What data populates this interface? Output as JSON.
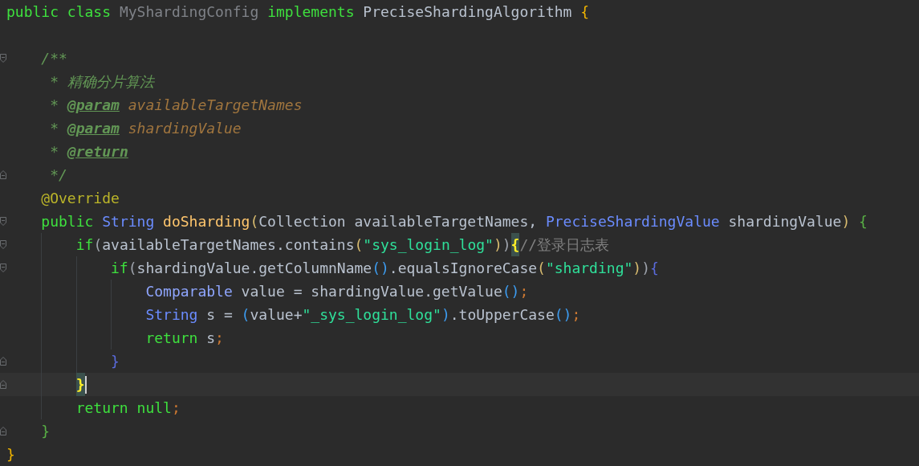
{
  "editor": {
    "lines": [
      {
        "tokens": [
          {
            "kind": "keyword",
            "text": "public class "
          },
          {
            "kind": "unused",
            "text": "MyShardingConfig "
          },
          {
            "kind": "keyword",
            "text": "implements "
          },
          {
            "kind": "plain",
            "text": "PreciseShardingAlgorithm "
          },
          {
            "kind": "brace",
            "text": "{"
          }
        ],
        "children": [
          {
            "fold_start": true,
            "tokens": [
              {
                "kind": "doc",
                "text": "/**"
              }
            ]
          },
          {
            "tokens": [
              {
                "kind": "doc",
                "text": " * 精确分片算法"
              }
            ]
          },
          {
            "tokens": [
              {
                "kind": "doc",
                "text": " * "
              },
              {
                "kind": "doctag",
                "text": "@param"
              },
              {
                "kind": "docparam",
                "text": " availableTargetNames"
              }
            ]
          },
          {
            "tokens": [
              {
                "kind": "doc",
                "text": " * "
              },
              {
                "kind": "doctag",
                "text": "@param"
              },
              {
                "kind": "docparam",
                "text": " shardingValue"
              }
            ]
          },
          {
            "tokens": [
              {
                "kind": "doc",
                "text": " * "
              },
              {
                "kind": "doctag",
                "text": "@return"
              }
            ]
          },
          {
            "fold_end": true,
            "tokens": [
              {
                "kind": "doc",
                "text": " */"
              }
            ]
          },
          {
            "tokens": [
              {
                "kind": "annotation",
                "text": "@Override"
              }
            ]
          },
          {
            "fold_start": true,
            "tokens": [
              {
                "kind": "keyword",
                "text": "public "
              },
              {
                "kind": "type",
                "text": "String "
              },
              {
                "kind": "method",
                "text": "doSharding"
              },
              {
                "kind": "paren-a",
                "text": "("
              },
              {
                "kind": "plain",
                "text": "Collection availableTargetNames, "
              },
              {
                "kind": "type",
                "text": "PreciseShardingValue "
              },
              {
                "kind": "plain",
                "text": "shardingValue"
              },
              {
                "kind": "paren-a",
                "text": ")"
              },
              {
                "kind": "paren-c",
                "text": " {"
              }
            ],
            "children": [
              {
                "fold_start": true,
                "tokens": [
                  {
                    "kind": "keyword",
                    "text": "if"
                  },
                  {
                    "kind": "paren-d",
                    "text": "("
                  },
                  {
                    "kind": "plain",
                    "text": "availableTargetNames.contains"
                  },
                  {
                    "kind": "paren-a",
                    "text": "("
                  },
                  {
                    "kind": "string",
                    "text": "\"sys_login_log\""
                  },
                  {
                    "kind": "paren-a",
                    "text": ")"
                  },
                  {
                    "kind": "paren-d",
                    "text": ")"
                  },
                  {
                    "kind": "brace-match",
                    "text": "{"
                  },
                  {
                    "kind": "comment",
                    "text": "//登录日志表"
                  }
                ],
                "children": [
                  {
                    "fold_start": true,
                    "tokens": [
                      {
                        "kind": "keyword",
                        "text": "if"
                      },
                      {
                        "kind": "paren-d",
                        "text": "("
                      },
                      {
                        "kind": "plain",
                        "text": "shardingValue.getColumnName"
                      },
                      {
                        "kind": "paren-b",
                        "text": "()"
                      },
                      {
                        "kind": "plain",
                        "text": ".equalsIgnoreCase"
                      },
                      {
                        "kind": "paren-a",
                        "text": "("
                      },
                      {
                        "kind": "string",
                        "text": "\"sharding\""
                      },
                      {
                        "kind": "paren-a",
                        "text": ")"
                      },
                      {
                        "kind": "paren-d",
                        "text": ")"
                      },
                      {
                        "kind": "paren-e",
                        "text": "{"
                      }
                    ],
                    "children": [
                      {
                        "tokens": [
                          {
                            "kind": "type-light",
                            "text": "Comparable "
                          },
                          {
                            "kind": "plain",
                            "text": "value = shardingValue.getValue"
                          },
                          {
                            "kind": "paren-b",
                            "text": "()"
                          },
                          {
                            "kind": "semicolon",
                            "text": ";"
                          }
                        ]
                      },
                      {
                        "tokens": [
                          {
                            "kind": "type",
                            "text": "String "
                          },
                          {
                            "kind": "plain",
                            "text": "s = "
                          },
                          {
                            "kind": "paren-b",
                            "text": "("
                          },
                          {
                            "kind": "plain",
                            "text": "value+"
                          },
                          {
                            "kind": "string",
                            "text": "\"_sys_login_log\""
                          },
                          {
                            "kind": "paren-b",
                            "text": ")"
                          },
                          {
                            "kind": "plain",
                            "text": ".toUpperCase"
                          },
                          {
                            "kind": "paren-b",
                            "text": "()"
                          },
                          {
                            "kind": "semicolon",
                            "text": ";"
                          }
                        ]
                      },
                      {
                        "tokens": [
                          {
                            "kind": "keyword",
                            "text": "return "
                          },
                          {
                            "kind": "plain",
                            "text": "s"
                          },
                          {
                            "kind": "semicolon",
                            "text": ";"
                          }
                        ]
                      }
                    ]
                  },
                  {
                    "fold_end": true,
                    "tokens": [
                      {
                        "kind": "paren-e",
                        "text": "}"
                      }
                    ]
                  }
                ]
              },
              {
                "fold_end": true,
                "current": true,
                "tokens": [
                  {
                    "kind": "brace-match",
                    "text": "}"
                  }
                ]
              },
              {
                "tokens": [
                  {
                    "kind": "keyword",
                    "text": "return null"
                  },
                  {
                    "kind": "semicolon",
                    "text": ";"
                  }
                ]
              }
            ]
          },
          {
            "fold_end": true,
            "tokens": [
              {
                "kind": "paren-c",
                "text": "}"
              }
            ]
          }
        ]
      },
      {
        "tokens": [
          {
            "kind": "brace",
            "text": "}"
          }
        ]
      }
    ]
  }
}
